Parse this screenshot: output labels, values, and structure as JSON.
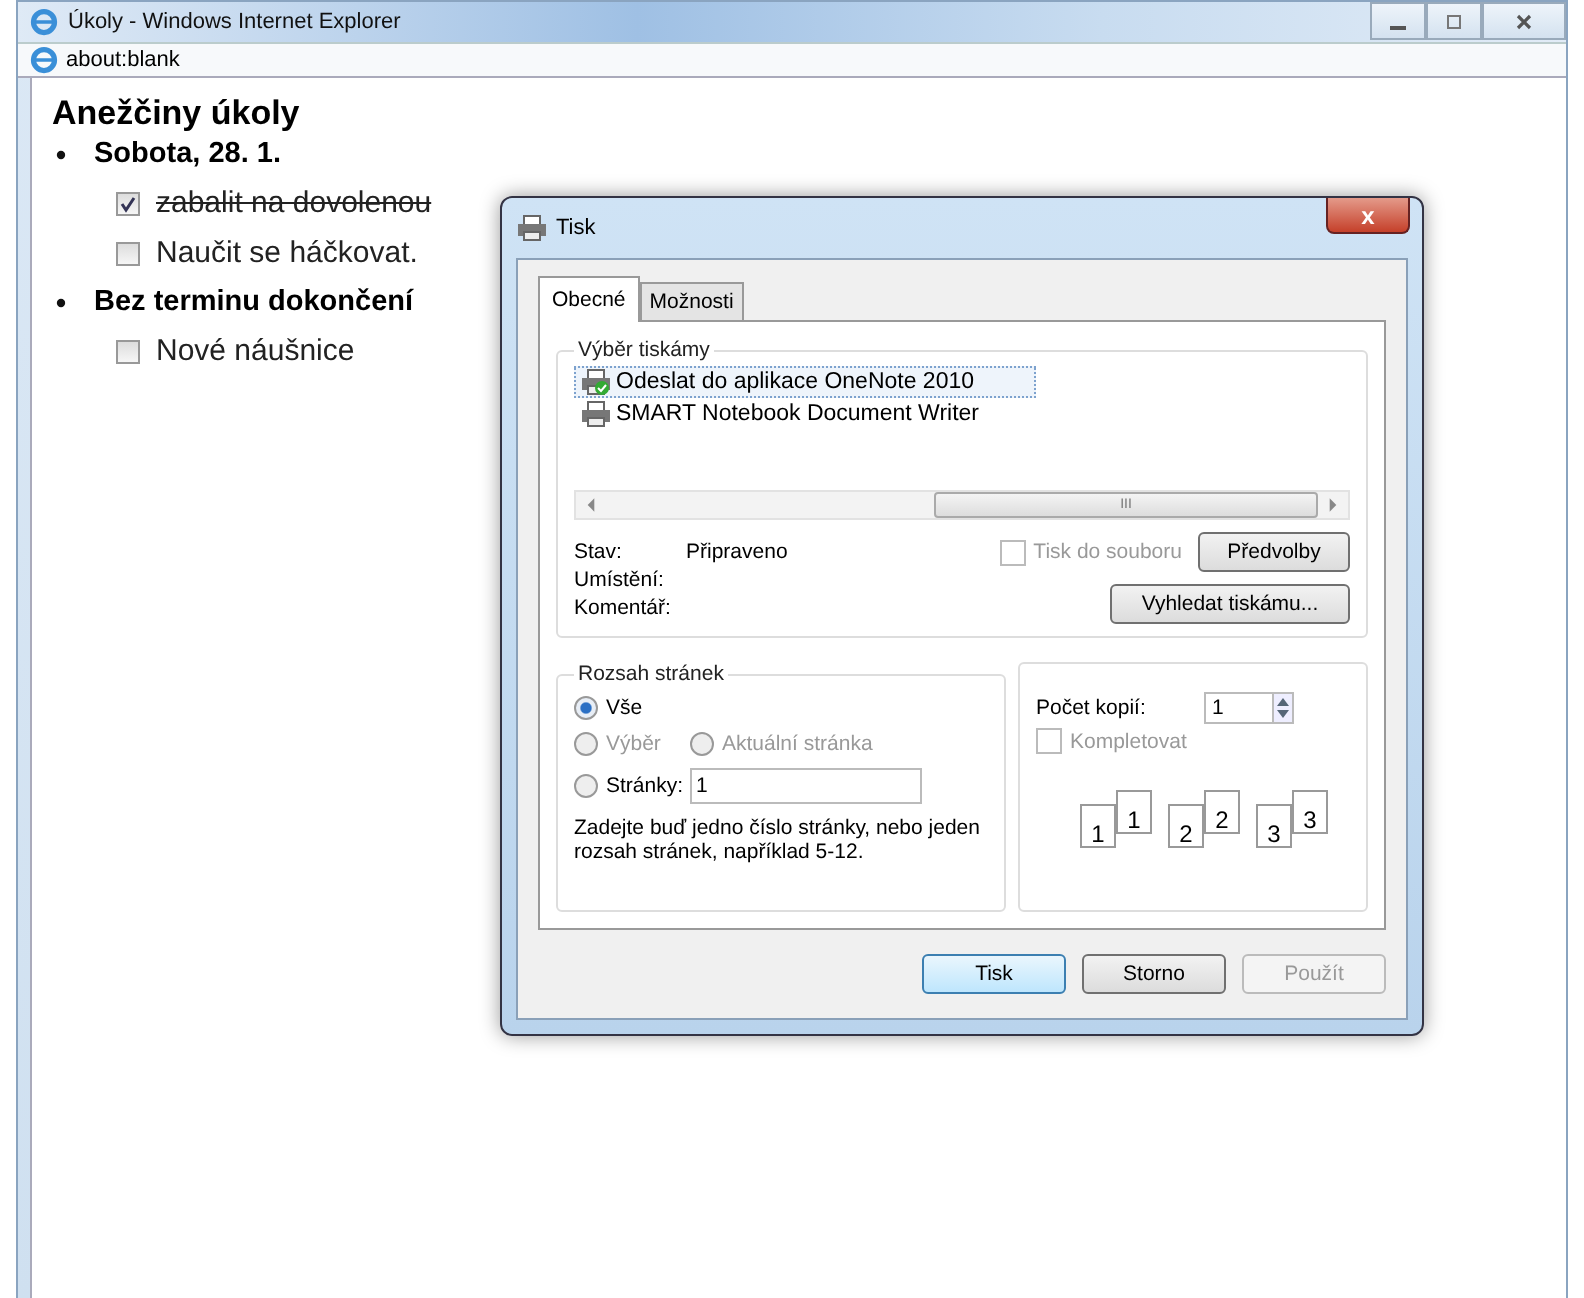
{
  "window": {
    "title": "Úkoly - Windows Internet Explorer"
  },
  "address_bar": {
    "value": "about:blank"
  },
  "page": {
    "heading": "Anežčiny úkoly",
    "groups": [
      {
        "title": "Sobota, 28. 1.",
        "tasks": [
          {
            "label": "zabalit na dovolenou",
            "checked": true
          },
          {
            "label": "Naučit se háčkovat.",
            "checked": false
          }
        ]
      },
      {
        "title": "Bez terminu dokončení",
        "tasks": [
          {
            "label": "Nové náušnice",
            "checked": false
          }
        ]
      }
    ]
  },
  "dialog": {
    "title": "Tisk",
    "close": "x",
    "tabs": [
      {
        "label": "Obecné",
        "selected": true
      },
      {
        "label": "Možnosti",
        "selected": false
      }
    ],
    "printer_group": {
      "legend": "Výběr tiskámy",
      "printers": [
        {
          "name": "Odeslat do aplikace OneNote 2010",
          "selected": true,
          "default": true
        },
        {
          "name": "SMART Notebook Document Writer",
          "selected": false,
          "default": false
        }
      ],
      "scroll_grip": "III"
    },
    "status": [
      {
        "label": "Stav:",
        "value": "Připraveno"
      },
      {
        "label": "Umístění:"
      },
      {
        "label": "Komentář:"
      }
    ],
    "print_to_file": {
      "label": "Tisk do souboru",
      "checked": false,
      "disabled": true
    },
    "preferences_button": "Předvolby",
    "find_button": "Vyhledat tiskámu...",
    "range": {
      "legend": "Rozsah stránek",
      "options": [
        {
          "label": "Vše",
          "selected": true,
          "disabled": false
        },
        {
          "label": "Výběr",
          "selected": false,
          "disabled": true
        },
        {
          "label": "Aktuální stránka",
          "selected": false,
          "disabled": true
        },
        {
          "label": "Stránky:",
          "selected": false,
          "disabled": false
        }
      ],
      "pages_value": "1",
      "hint": "Zadejte buď jedno číslo stránky, nebo jeden rozsah stránek, například 5-12."
    },
    "copies": {
      "label": "Počet kopií:",
      "value": "1",
      "collate": {
        "label": "Kompletovat",
        "checked": false,
        "disabled": true
      },
      "pages": [
        "1",
        "1",
        "2",
        "2",
        "3",
        "3"
      ]
    },
    "buttons": [
      {
        "label": "Tisk",
        "default": true,
        "disabled": false
      },
      {
        "label": "Storno",
        "default": false,
        "disabled": false
      },
      {
        "label": "Použít",
        "default": false,
        "disabled": true
      }
    ]
  }
}
